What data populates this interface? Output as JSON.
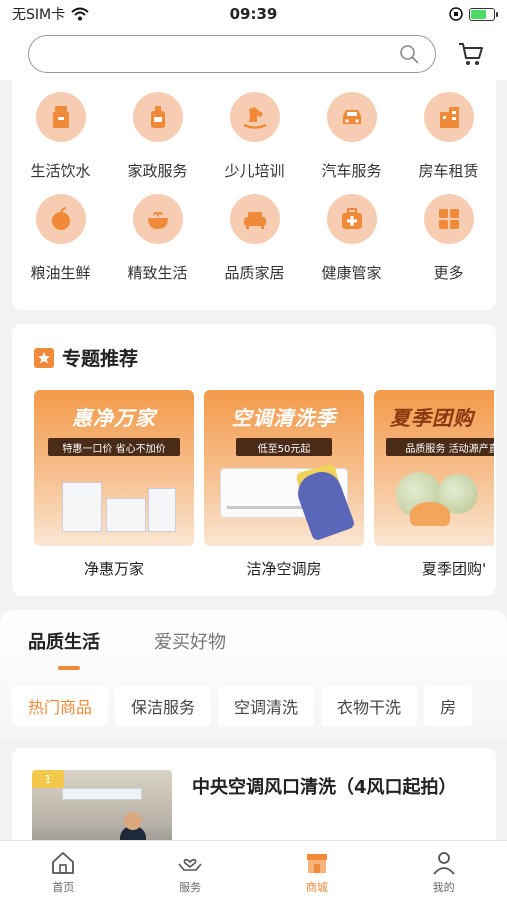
{
  "status_bar": {
    "carrier": "无SIM卡",
    "time": "09:39"
  },
  "header": {
    "search_placeholder": ""
  },
  "categories": [
    {
      "label": "生活饮水",
      "icon": "water-dispenser-icon"
    },
    {
      "label": "家政服务",
      "icon": "cleaning-bottle-icon"
    },
    {
      "label": "少儿培训",
      "icon": "rocking-horse-icon"
    },
    {
      "label": "汽车服务",
      "icon": "car-icon"
    },
    {
      "label": "房车租赁",
      "icon": "building-icon"
    },
    {
      "label": "粮油生鲜",
      "icon": "apple-icon"
    },
    {
      "label": "精致生活",
      "icon": "bowl-icon"
    },
    {
      "label": "品质家居",
      "icon": "sofa-icon"
    },
    {
      "label": "健康管家",
      "icon": "medical-kit-icon"
    },
    {
      "label": "更多",
      "icon": "grid-icon"
    }
  ],
  "special": {
    "title": "专题推荐",
    "promos": [
      {
        "headline": "惠净万家",
        "tag": "特惠一口价 省心不加价",
        "label": "净惠万家"
      },
      {
        "headline": "空调清洗季",
        "tag": "低至50元起",
        "label": "洁净空调房"
      },
      {
        "headline": "夏季团购",
        "tag": "品质服务 活动源产直供",
        "label": "夏季团购'"
      }
    ]
  },
  "tabs": {
    "main": [
      "品质生活",
      "爱买好物"
    ],
    "chips": [
      "热门商品",
      "保洁服务",
      "空调清洗",
      "衣物干洗",
      "房"
    ]
  },
  "product": {
    "badge": "1",
    "title": "中央空调风口清洗（4风口起拍）"
  },
  "bottom_nav": [
    {
      "label": "首页",
      "icon": "home-icon"
    },
    {
      "label": "服务",
      "icon": "hand-heart-icon"
    },
    {
      "label": "商城",
      "icon": "shop-icon"
    },
    {
      "label": "我的",
      "icon": "user-icon"
    }
  ],
  "colors": {
    "accent": "#f08a38",
    "icon_bg": "#f6cdb3",
    "background": "#f2f2f2"
  }
}
